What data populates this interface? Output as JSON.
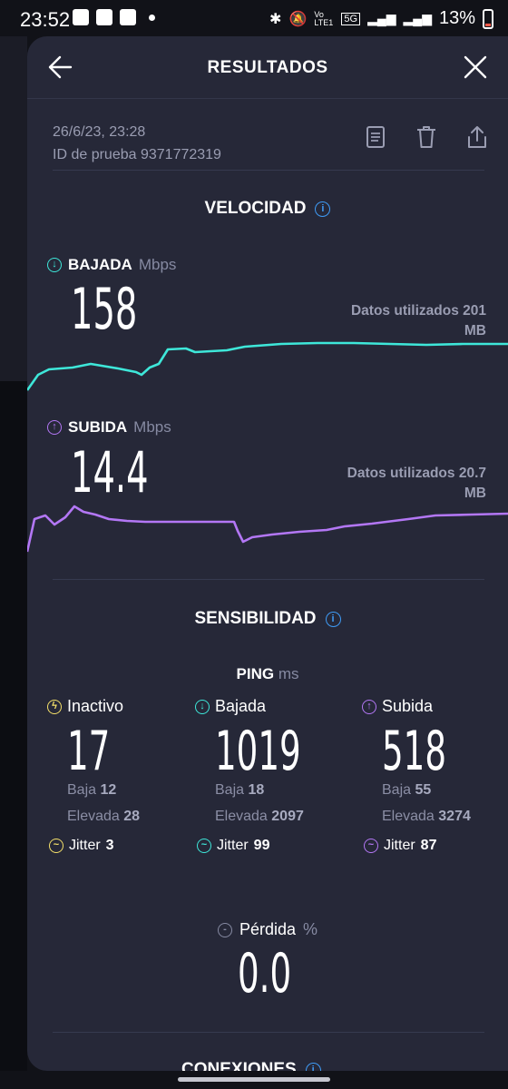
{
  "status_bar": {
    "time": "23:52",
    "network_type": "5G",
    "battery": "13%",
    "volte": "Vo LTE1"
  },
  "header": {
    "title": "RESULTADOS",
    "back_icon": "arrow-left-icon",
    "close_icon": "close-icon"
  },
  "test_info": {
    "date": "26/6/23, 23:28",
    "test_id_label": "ID de prueba",
    "test_id": "9371772319",
    "actions": [
      "document-icon",
      "trash-icon",
      "share-icon"
    ]
  },
  "velocity": {
    "title": "VELOCIDAD",
    "download": {
      "label": "BAJADA",
      "unit": "Mbps",
      "value": "158",
      "data_used_line1": "Datos utilizados 201",
      "data_used_line2": "MB",
      "color": "#3ee7d9"
    },
    "upload": {
      "label": "SUBIDA",
      "unit": "Mbps",
      "value": "14.4",
      "data_used_line1": "Datos utilizados 20.7",
      "data_used_line2": "MB",
      "color": "#b377f5"
    }
  },
  "sensitivity": {
    "title": "SENSIBILIDAD",
    "ping": {
      "label": "PING",
      "unit": "ms"
    },
    "columns": [
      {
        "label": "Inactivo",
        "value": "17",
        "low_label": "Baja",
        "low": "12",
        "high_label": "Elevada",
        "high": "28",
        "jitter_label": "Jitter",
        "jitter": "3",
        "color": "#f5e06a"
      },
      {
        "label": "Bajada",
        "value": "1019",
        "low_label": "Baja",
        "low": "18",
        "high_label": "Elevada",
        "high": "2097",
        "jitter_label": "Jitter",
        "jitter": "99",
        "color": "#3ee7d9"
      },
      {
        "label": "Subida",
        "value": "518",
        "low_label": "Baja",
        "low": "55",
        "high_label": "Elevada",
        "high": "3274",
        "jitter_label": "Jitter",
        "jitter": "87",
        "color": "#b377f5"
      }
    ],
    "loss": {
      "label": "Pérdida",
      "unit": "%",
      "value": "0.0"
    }
  },
  "next_section": {
    "title": "CONEXIONES"
  }
}
